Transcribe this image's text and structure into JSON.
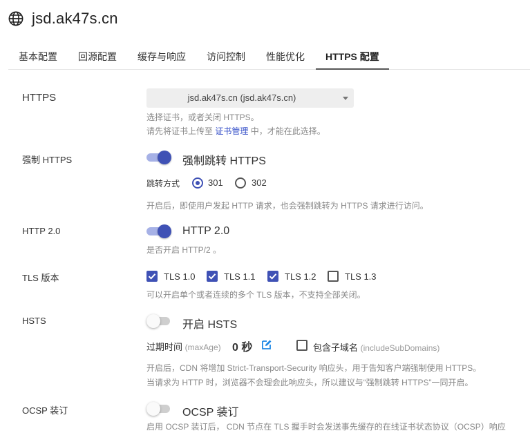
{
  "header": {
    "title": "jsd.ak47s.cn",
    "icon": "globe-icon"
  },
  "tabs": [
    {
      "label": "基本配置"
    },
    {
      "label": "回源配置"
    },
    {
      "label": "缓存与响应"
    },
    {
      "label": "访问控制"
    },
    {
      "label": "性能优化"
    },
    {
      "label": "HTTPS 配置",
      "active": true
    }
  ],
  "https": {
    "label": "HTTPS",
    "select_value": "jsd.ak47s.cn (jsd.ak47s.cn)",
    "help1": "选择证书，或者关闭 HTTPS。",
    "help2_pre": "请先将证书上传至 ",
    "help2_link": "证书管理",
    "help2_post": " 中，才能在此选择。"
  },
  "force_https": {
    "label": "强制 HTTPS",
    "switch_label": "强制跳转 HTTPS",
    "enabled": true,
    "redirect_label": "跳转方式",
    "options": [
      "301",
      "302"
    ],
    "selected": "301",
    "help": "开启后，即使用户发起 HTTP 请求，也会强制跳转为 HTTPS 请求进行访问。"
  },
  "http2": {
    "label": "HTTP 2.0",
    "switch_label": "HTTP 2.0",
    "enabled": true,
    "help": "是否开启 HTTP/2 。"
  },
  "tls": {
    "label": "TLS 版本",
    "versions": [
      {
        "name": "TLS 1.0",
        "checked": true
      },
      {
        "name": "TLS 1.1",
        "checked": true
      },
      {
        "name": "TLS 1.2",
        "checked": true
      },
      {
        "name": "TLS 1.3",
        "checked": false
      }
    ],
    "help": "可以开启单个或者连续的多个 TLS 版本，不支持全部关闭。"
  },
  "hsts": {
    "label": "HSTS",
    "switch_label": "开启 HSTS",
    "enabled": false,
    "max_age_label": "过期时间",
    "max_age_sub": "(maxAge)",
    "max_age_value": "0 秒",
    "include_label": "包含子域名",
    "include_sub": "(includeSubDomains)",
    "include_checked": false,
    "help1": "开启后，CDN 将增加 Strict-Transport-Security 响应头，用于告知客户端强制使用 HTTPS。",
    "help2": "当请求为 HTTP 时，浏览器不会理会此响应头，所以建议与“强制跳转 HTTPS”一同开启。"
  },
  "ocsp": {
    "label": "OCSP 装订",
    "switch_label": "OCSP 装订",
    "enabled": false,
    "help": "启用 OCSP 装订后， CDN 节点在 TLS 握手时会发送事先缓存的在线证书状态协议（OCSP）响应"
  },
  "colors": {
    "accent": "#3f51b5",
    "link": "#3650c8",
    "help_text": "#888888"
  }
}
